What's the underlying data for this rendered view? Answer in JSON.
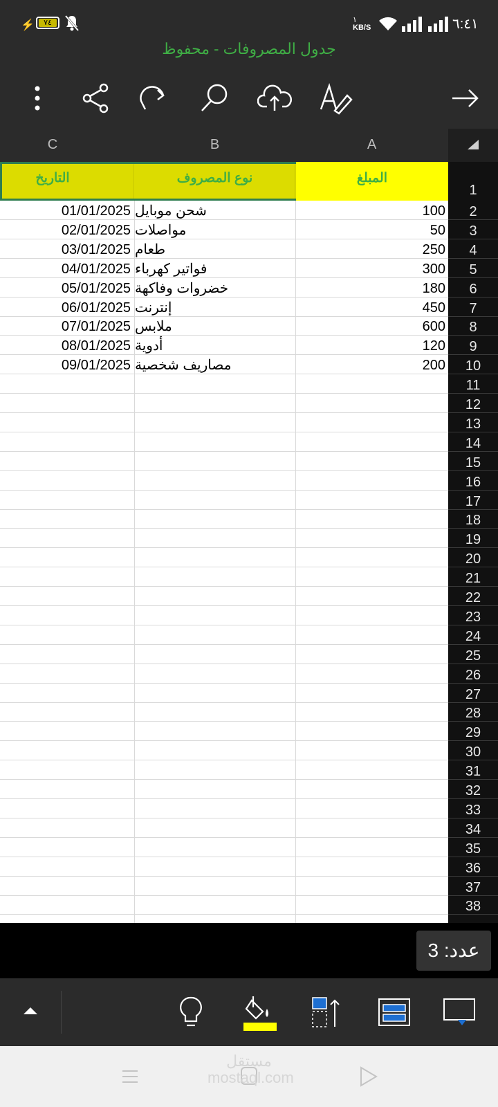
{
  "status_bar": {
    "time": "٦:٤١",
    "battery": "٧٤",
    "net_speed": "KB/S",
    "net_value": "١"
  },
  "title": "جدول المصروفات - محفوظ",
  "columns": [
    "C",
    "B",
    "A"
  ],
  "header_row": {
    "A": "المبلغ",
    "B": "نوع المصروف",
    "C": "التاريخ",
    "row_number": "1"
  },
  "rows": [
    {
      "num": "2",
      "A": "100",
      "B": "شحن موبايل",
      "C": "01/01/2025"
    },
    {
      "num": "3",
      "A": "50",
      "B": "مواصلات",
      "C": "02/01/2025"
    },
    {
      "num": "4",
      "A": "250",
      "B": "طعام",
      "C": "03/01/2025"
    },
    {
      "num": "5",
      "A": "300",
      "B": "فواتير كهرباء",
      "C": "04/01/2025"
    },
    {
      "num": "6",
      "A": "180",
      "B": "خضروات وفاكهة",
      "C": "05/01/2025"
    },
    {
      "num": "7",
      "A": "450",
      "B": "إنترنت",
      "C": "06/01/2025"
    },
    {
      "num": "8",
      "A": "600",
      "B": "ملابس",
      "C": "07/01/2025"
    },
    {
      "num": "9",
      "A": "120",
      "B": "أدوية",
      "C": "08/01/2025"
    },
    {
      "num": "10",
      "A": "200",
      "B": "مصاريف شخصية",
      "C": "09/01/2025"
    }
  ],
  "empty_rows": [
    "11",
    "12",
    "13",
    "14",
    "15",
    "16",
    "17",
    "18",
    "19",
    "20",
    "21",
    "22",
    "23",
    "24",
    "25",
    "26",
    "27",
    "28",
    "29",
    "30",
    "31",
    "32",
    "33",
    "34",
    "35",
    "36",
    "37",
    "38"
  ],
  "count_label": "عدد: 3",
  "colors": {
    "accent": "#3fae45",
    "header_fill": "#dcdc00",
    "selected_fill": "#ffff00",
    "selection_border": "#2e7d4f"
  },
  "watermark": "مستقل mostaql.com"
}
